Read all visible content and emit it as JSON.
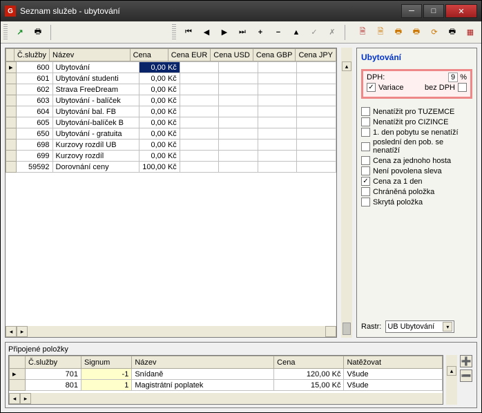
{
  "window": {
    "title": "Seznam služeb - ubytování",
    "app_icon": "G"
  },
  "toolbar": {
    "icons": [
      "arrow-up",
      "print",
      "sep",
      "first",
      "prev",
      "next",
      "last",
      "add",
      "remove",
      "edit",
      "confirm",
      "cancel",
      "sep",
      "doc-red",
      "doc-orange",
      "print2",
      "print3",
      "refresh",
      "print4",
      "flag"
    ]
  },
  "grid": {
    "headers": [
      "Č.služby",
      "Název",
      "Cena",
      "Cena EUR",
      "Cena USD",
      "Cena GBP",
      "Cena JPY"
    ],
    "rows": [
      {
        "c": "600",
        "nazev": "Ubytování",
        "cena": "0,00 Kč",
        "sel": true
      },
      {
        "c": "601",
        "nazev": "Ubytování studenti",
        "cena": "0,00 Kč"
      },
      {
        "c": "602",
        "nazev": "Strava FreeDream",
        "cena": "0,00 Kč"
      },
      {
        "c": "603",
        "nazev": "Ubytování - balíček",
        "cena": "0,00 Kč"
      },
      {
        "c": "604",
        "nazev": "Ubytování bal. FB",
        "cena": "0,00 Kč"
      },
      {
        "c": "605",
        "nazev": "Ubytování-balíček B",
        "cena": "0,00 Kč"
      },
      {
        "c": "650",
        "nazev": "Ubytování - gratuita",
        "cena": "0,00 Kč"
      },
      {
        "c": "698",
        "nazev": "Kurzovy rozdíl UB",
        "cena": "0,00 Kč"
      },
      {
        "c": "699",
        "nazev": "Kurzovy rozdíl",
        "cena": "0,00 Kč"
      },
      {
        "c": "59592",
        "nazev": "Dorovnání ceny",
        "cena": "100,00 Kč"
      }
    ]
  },
  "right": {
    "title": "Ubytování",
    "dph_label": "DPH:",
    "dph_value": "9",
    "dph_pct": "%",
    "variace": "Variace",
    "bezdph": "bez DPH",
    "checks": [
      {
        "label": "Nenatížit pro TUZEMCE",
        "v": false
      },
      {
        "label": "Nenatížit pro CIZINCE",
        "v": false
      },
      {
        "label": "1. den pobytu se nenatíží",
        "v": false
      },
      {
        "label": "poslední den pob. se nenatíží",
        "v": false
      },
      {
        "label": "Cena za jednoho hosta",
        "v": false
      },
      {
        "label": "Není povolena sleva",
        "v": false
      },
      {
        "label": "Cena za 1 den",
        "v": true
      },
      {
        "label": "Chráněná položka",
        "v": false
      },
      {
        "label": "Skrytá položka",
        "v": false
      }
    ],
    "rastr_label": "Rastr:",
    "rastr_value": "UB Ubytování"
  },
  "bottom": {
    "title": "Připojené položky",
    "headers": [
      "Č.služby",
      "Signum",
      "Název",
      "Cena",
      "Natěžovat"
    ],
    "rows": [
      {
        "c": "701",
        "signum": "-1",
        "nazev": "Snídaně",
        "cena": "120,00 Kč",
        "nat": "Všude"
      },
      {
        "c": "801",
        "signum": "1",
        "nazev": "Magistrátní poplatek",
        "cena": "15,00 Kč",
        "nat": "Všude"
      }
    ]
  }
}
